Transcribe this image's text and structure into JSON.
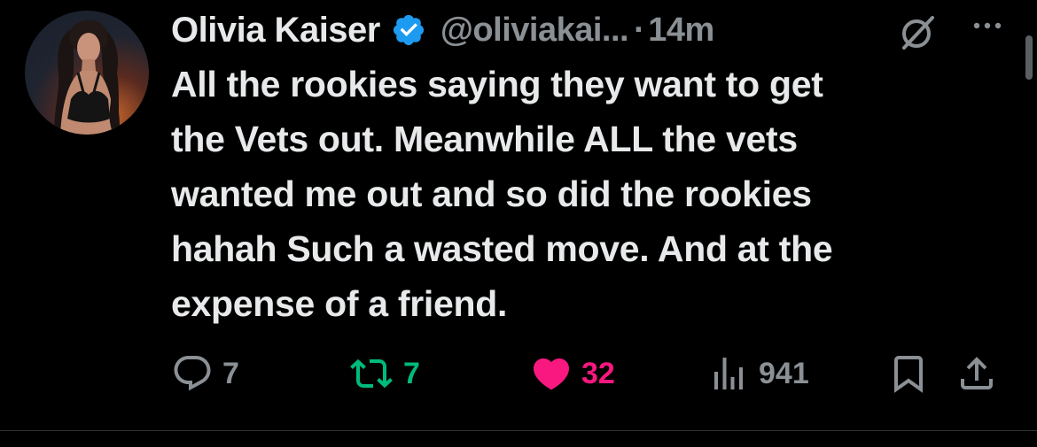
{
  "tweet": {
    "author_name": "Olivia Kaiser",
    "handle": "@oliviakai...",
    "separator": "·",
    "time": "14m",
    "text_lines": [
      "All the rookies saying they want to get",
      "the Vets out. Meanwhile ALL the vets",
      "wanted me out and so did the rookies",
      "hahah Such a wasted move. And at the",
      "expense of a friend."
    ],
    "replies": "7",
    "reposts": "7",
    "likes": "32",
    "views": "941"
  },
  "colors": {
    "background": "#000000",
    "text": "#e7e9ea",
    "muted": "#8b9095",
    "verified": "#1d9bf0",
    "repost": "#00ba7c",
    "like": "#f91880"
  },
  "icons": {
    "verified": "verified-badge-icon",
    "grok": "grok-icon",
    "more": "more-dots-icon",
    "reply": "reply-icon",
    "repost": "repost-icon",
    "like": "heart-icon",
    "views": "views-bar-chart-icon",
    "bookmark": "bookmark-icon",
    "share": "share-icon"
  },
  "state": {
    "liked": true,
    "reposted": true
  }
}
